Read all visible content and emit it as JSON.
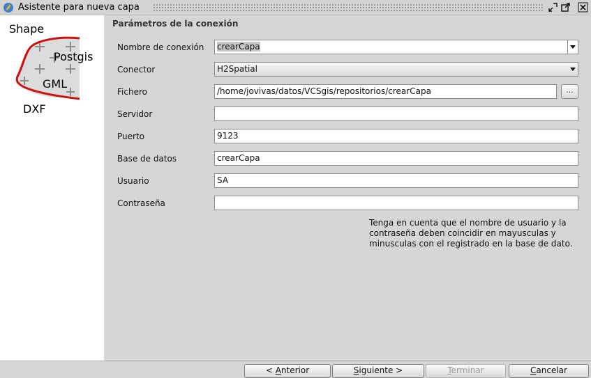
{
  "window": {
    "title": "Asistente para nueva capa"
  },
  "logo": {
    "labels": [
      "Shape",
      "Postgis",
      "GML",
      "DXF"
    ]
  },
  "form": {
    "section_title": "Parámetros de la conexión",
    "fields": {
      "connection_name": {
        "label": "Nombre de conexión",
        "value": "crearCapa"
      },
      "connector": {
        "label": "Conector",
        "value": "H2Spatial"
      },
      "file": {
        "label": "Fichero",
        "value": "/home/jovivas/datos/VCSgis/repositorios/crearCapa",
        "browse_label": "..."
      },
      "server": {
        "label": "Servidor",
        "value": ""
      },
      "port": {
        "label": "Puerto",
        "value": "9123"
      },
      "database": {
        "label": "Base de datos",
        "value": "crearCapa"
      },
      "user": {
        "label": "Usuario",
        "value": "SA"
      },
      "password": {
        "label": "Contraseña",
        "value": ""
      }
    },
    "note": "Tenga en cuenta que el nombre de usuario y la contraseña deben coincidir en mayusculas y minusculas con el registrado en la base de dato."
  },
  "buttons": {
    "previous": {
      "prefix": "< ",
      "mnemonic": "A",
      "rest": "nterior"
    },
    "next": {
      "mnemonic": "S",
      "rest": "iguiente >"
    },
    "finish": {
      "mnemonic": "T",
      "rest": "erminar",
      "enabled": false
    },
    "cancel": {
      "mnemonic": "C",
      "rest": "ancelar"
    }
  },
  "colors": {
    "logo_curve": "#cc1111",
    "panel_bg": "#d6d6d6"
  }
}
